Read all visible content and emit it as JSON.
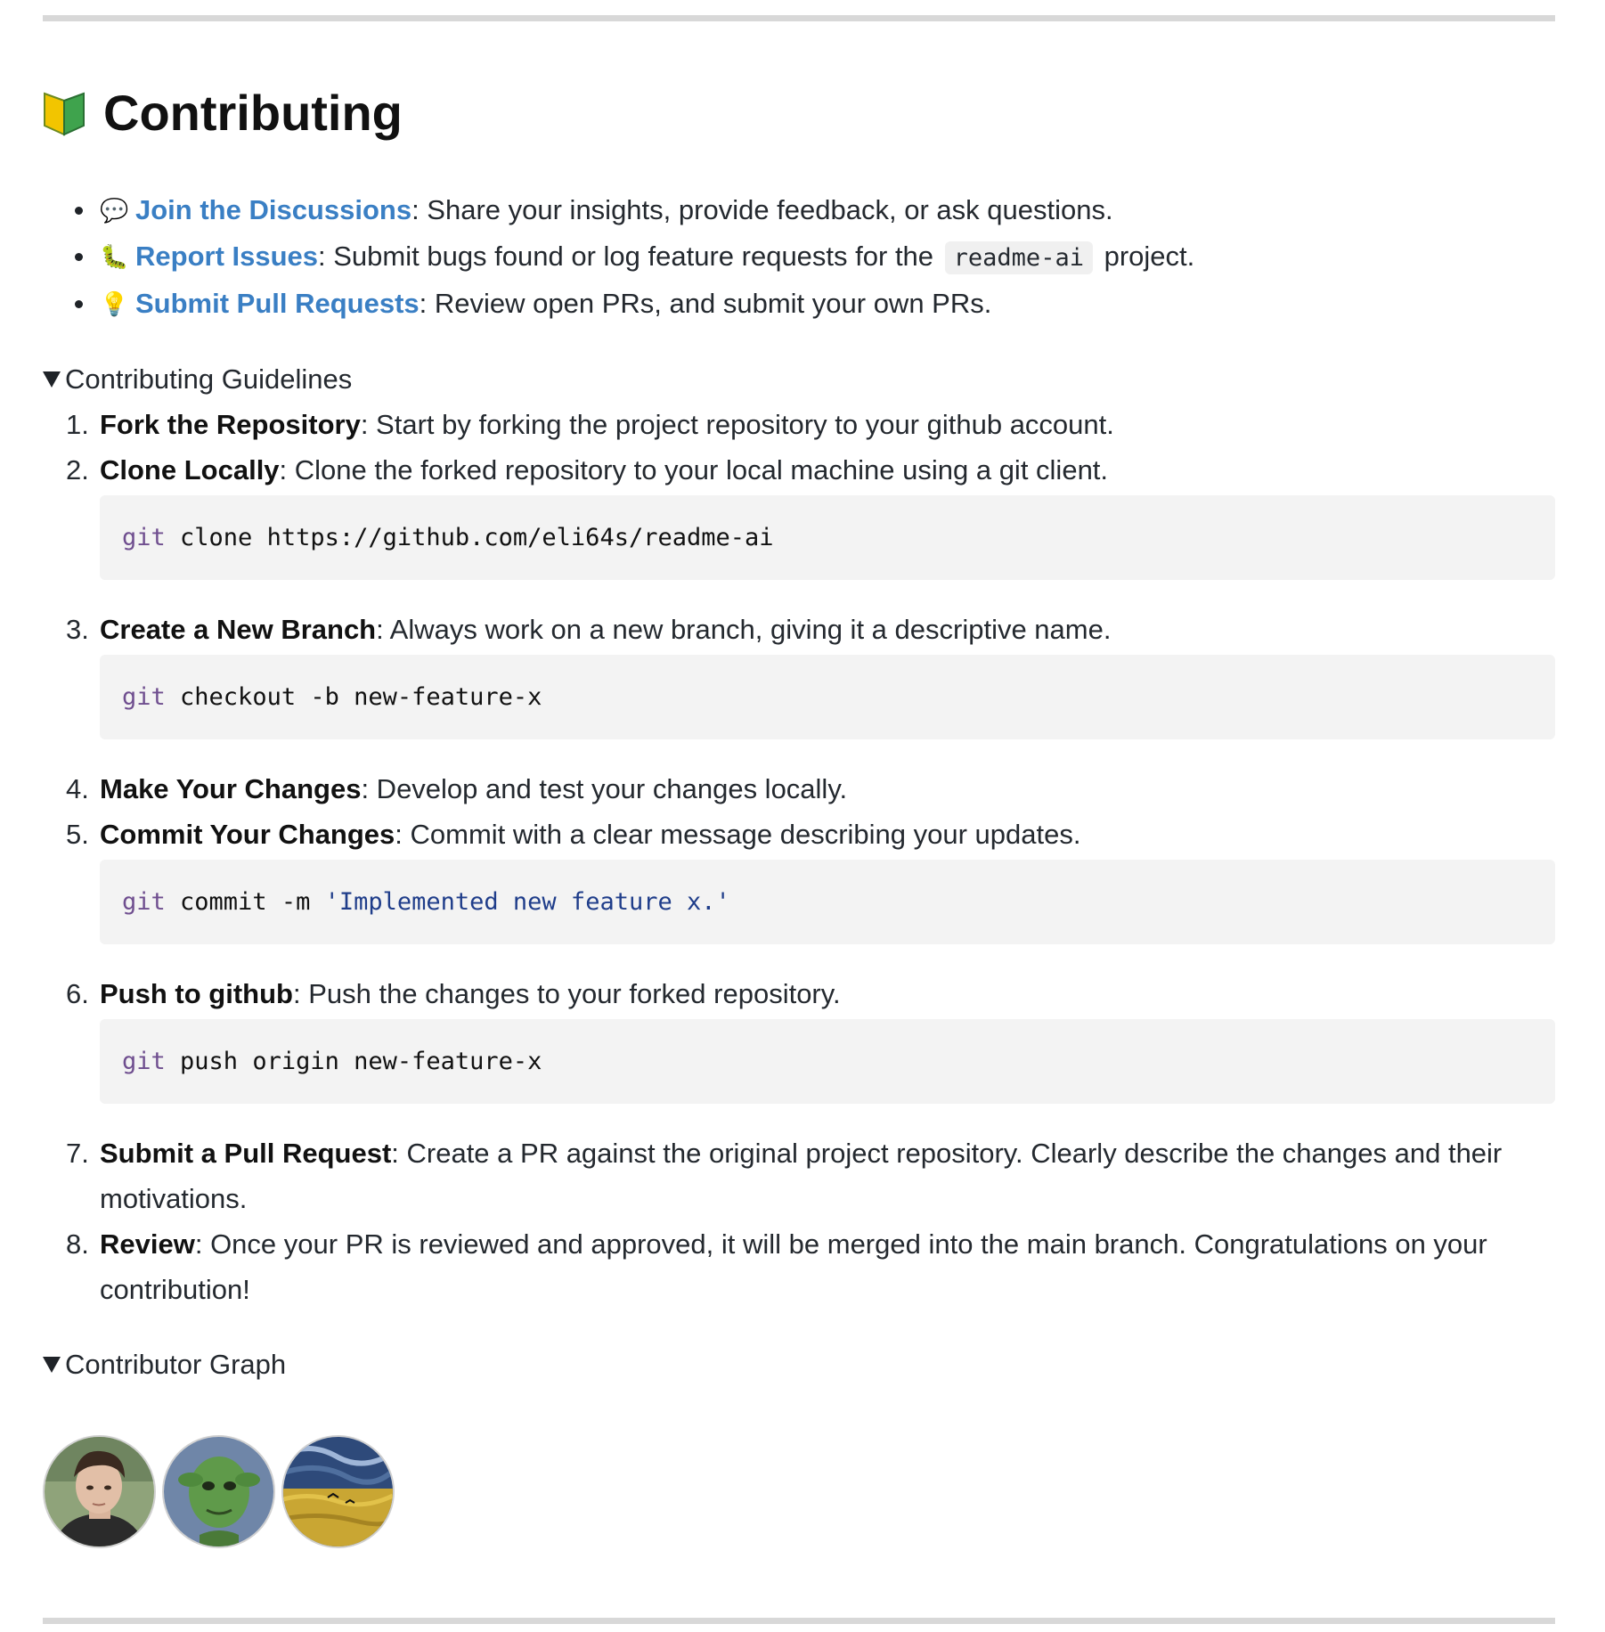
{
  "heading": {
    "icon": "beginner-shield-icon",
    "title": "Contributing"
  },
  "links": [
    {
      "icon": "speech-bubble-icon",
      "emoji": "💬",
      "label": "Join the Discussions",
      "text": ": Share your insights, provide feedback, or ask questions."
    },
    {
      "icon": "bug-icon",
      "emoji": "🐛",
      "label": "Report Issues",
      "text_before": ": Submit bugs found or log feature requests for the ",
      "code": "readme-ai",
      "text_after": " project."
    },
    {
      "icon": "lightbulb-icon",
      "emoji": "💡",
      "label": "Submit Pull Requests",
      "text": ": Review open PRs, and submit your own PRs."
    }
  ],
  "guidelines": {
    "summary": "Contributing Guidelines",
    "steps": [
      {
        "num": "1.",
        "title": "Fork the Repository",
        "text": ": Start by forking the project repository to your github account."
      },
      {
        "num": "2.",
        "title": "Clone Locally",
        "text": ": Clone the forked repository to your local machine using a git client.",
        "code_kw": "git",
        "code_rest": " clone https://github.com/eli64s/readme-ai"
      },
      {
        "num": "3.",
        "title": "Create a New Branch",
        "text": ": Always work on a new branch, giving it a descriptive name.",
        "code_kw": "git",
        "code_rest": " checkout -b new-feature-x"
      },
      {
        "num": "4.",
        "title": "Make Your Changes",
        "text": ": Develop and test your changes locally."
      },
      {
        "num": "5.",
        "title": "Commit Your Changes",
        "text": ": Commit with a clear message describing your updates.",
        "code_kw": "git",
        "code_rest": " commit -m ",
        "code_str": "'Implemented new feature x.'"
      },
      {
        "num": "6.",
        "title": "Push to github",
        "text": ": Push the changes to your forked repository.",
        "code_kw": "git",
        "code_rest": " push origin new-feature-x"
      },
      {
        "num": "7.",
        "title": "Submit a Pull Request",
        "text": ": Create a PR against the original project repository. Clearly describe the changes and their motivations."
      },
      {
        "num": "8.",
        "title": "Review",
        "text": ": Once your PR is reviewed and approved, it will be merged into the main branch. Congratulations on your contribution!"
      }
    ]
  },
  "graph": {
    "summary": "Contributor Graph",
    "avatars": [
      "avatar-person-photo",
      "avatar-green-creature",
      "avatar-wheatfield-painting"
    ]
  },
  "colors": {
    "link": "#3a7fc4",
    "code_bg": "#f3f3f3",
    "rule": "#d8d8d8",
    "code_keyword": "#6f4e8f",
    "code_string": "#1f3d8a"
  }
}
